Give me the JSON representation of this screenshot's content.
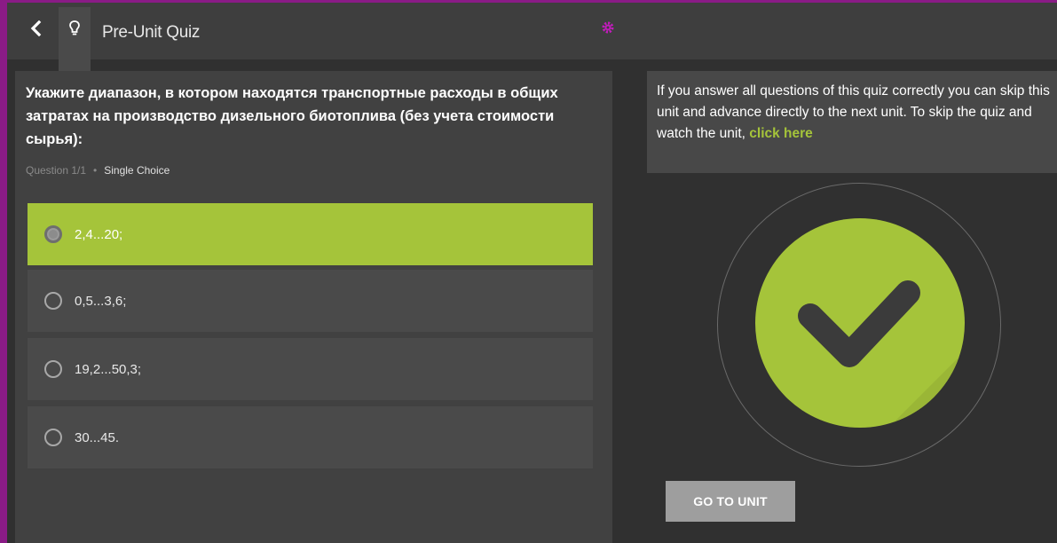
{
  "header": {
    "title": "Pre-Unit Quiz",
    "back_icon": "chevron-left-icon",
    "hint_icon": "lightbulb-icon",
    "settings_icon": "gear-icon"
  },
  "question": {
    "text": "Укажите диапазон, в котором находятся транспортные расходы в общих затратах на производство дизельного биотоплива (без учета стоимости сырья):",
    "counter": "Question 1/1",
    "separator": "•",
    "type": "Single Choice",
    "options": [
      {
        "label": "2,4...20;",
        "selected": true
      },
      {
        "label": "0,5...3,6;",
        "selected": false
      },
      {
        "label": "19,2...50,3;",
        "selected": false
      },
      {
        "label": "30...45.",
        "selected": false
      }
    ]
  },
  "info": {
    "text": "If you answer all questions of this quiz correctly you can skip this unit and advance directly to the next unit. To skip the quiz and watch the unit, ",
    "link": "click here"
  },
  "result": {
    "icon": "checkmark-icon"
  },
  "actions": {
    "go_to_unit": "GO TO UNIT"
  },
  "colors": {
    "accent": "#a5c43a",
    "frame": "#8a1b86",
    "background": "#303030",
    "panel": "#414141"
  }
}
